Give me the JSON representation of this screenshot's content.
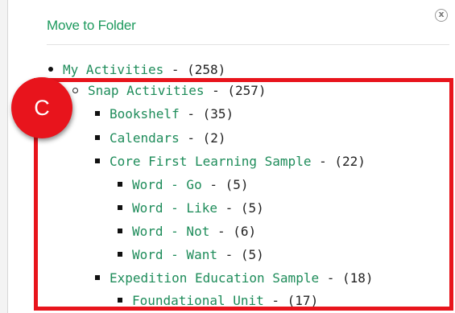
{
  "dialog": {
    "title": "Move to Folder",
    "close_glyph": "x"
  },
  "callout": {
    "label": "C"
  },
  "tree": {
    "my_activities": {
      "name": "My Activities",
      "count": " - (258)"
    },
    "snap_activities": {
      "name": "Snap Activities",
      "count": " - (257)"
    },
    "bookshelf": {
      "name": "Bookshelf",
      "count": " - (35)"
    },
    "calendars": {
      "name": "Calendars",
      "count": " - (2)"
    },
    "core_first": {
      "name": "Core First Learning Sample",
      "count": " - (22)"
    },
    "word_go": {
      "name": "Word - Go",
      "count": " - (5)"
    },
    "word_like": {
      "name": "Word - Like",
      "count": " - (5)"
    },
    "word_not": {
      "name": "Word - Not",
      "count": " - (6)"
    },
    "word_want": {
      "name": "Word - Want",
      "count": " - (5)"
    },
    "expedition": {
      "name": "Expedition Education Sample",
      "count": " - (18)"
    },
    "foundational": {
      "name": "Foundational Unit",
      "count": " - (17)"
    }
  },
  "colors": {
    "link": "#1e8c5a",
    "title": "#1e9a5e",
    "highlight": "#e8141c"
  }
}
